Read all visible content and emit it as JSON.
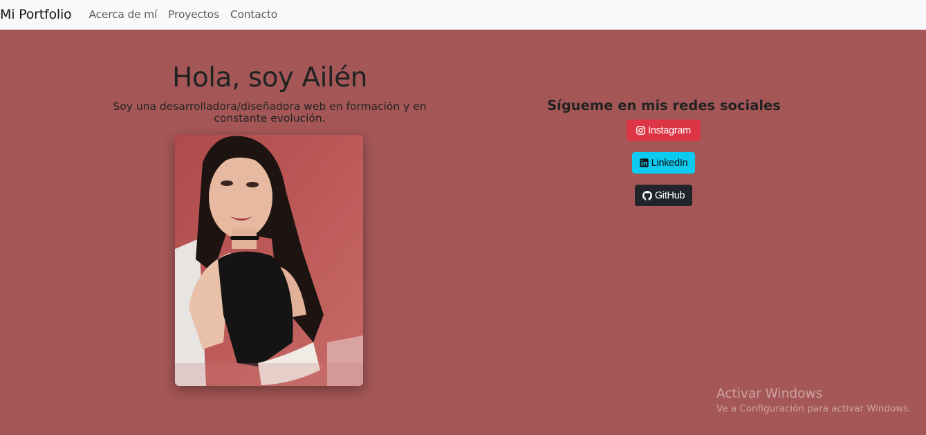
{
  "nav": {
    "brand": "Mi Portfolio",
    "links": [
      "Acerca de mí",
      "Proyectos",
      "Contacto"
    ]
  },
  "hero": {
    "title": "Hola, soy Ailén",
    "subtitle": "Soy una desarrolladora/diseñadora web en formación y en constante evolución."
  },
  "social": {
    "title": "Sígueme en mis redes sociales",
    "buttons": [
      {
        "label": "Instagram",
        "icon": "instagram-icon",
        "color": "#dc3545"
      },
      {
        "label": "LinkedIn",
        "icon": "linkedin-icon",
        "color": "#0dcaf0"
      },
      {
        "label": "GitHub",
        "icon": "github-icon",
        "color": "#212529"
      }
    ]
  },
  "watermark": {
    "title": "Activar Windows",
    "subtitle": "Ve a Configuración para activar Windows."
  },
  "colors": {
    "background": "#a45756",
    "navbar": "#f8f9fa"
  }
}
